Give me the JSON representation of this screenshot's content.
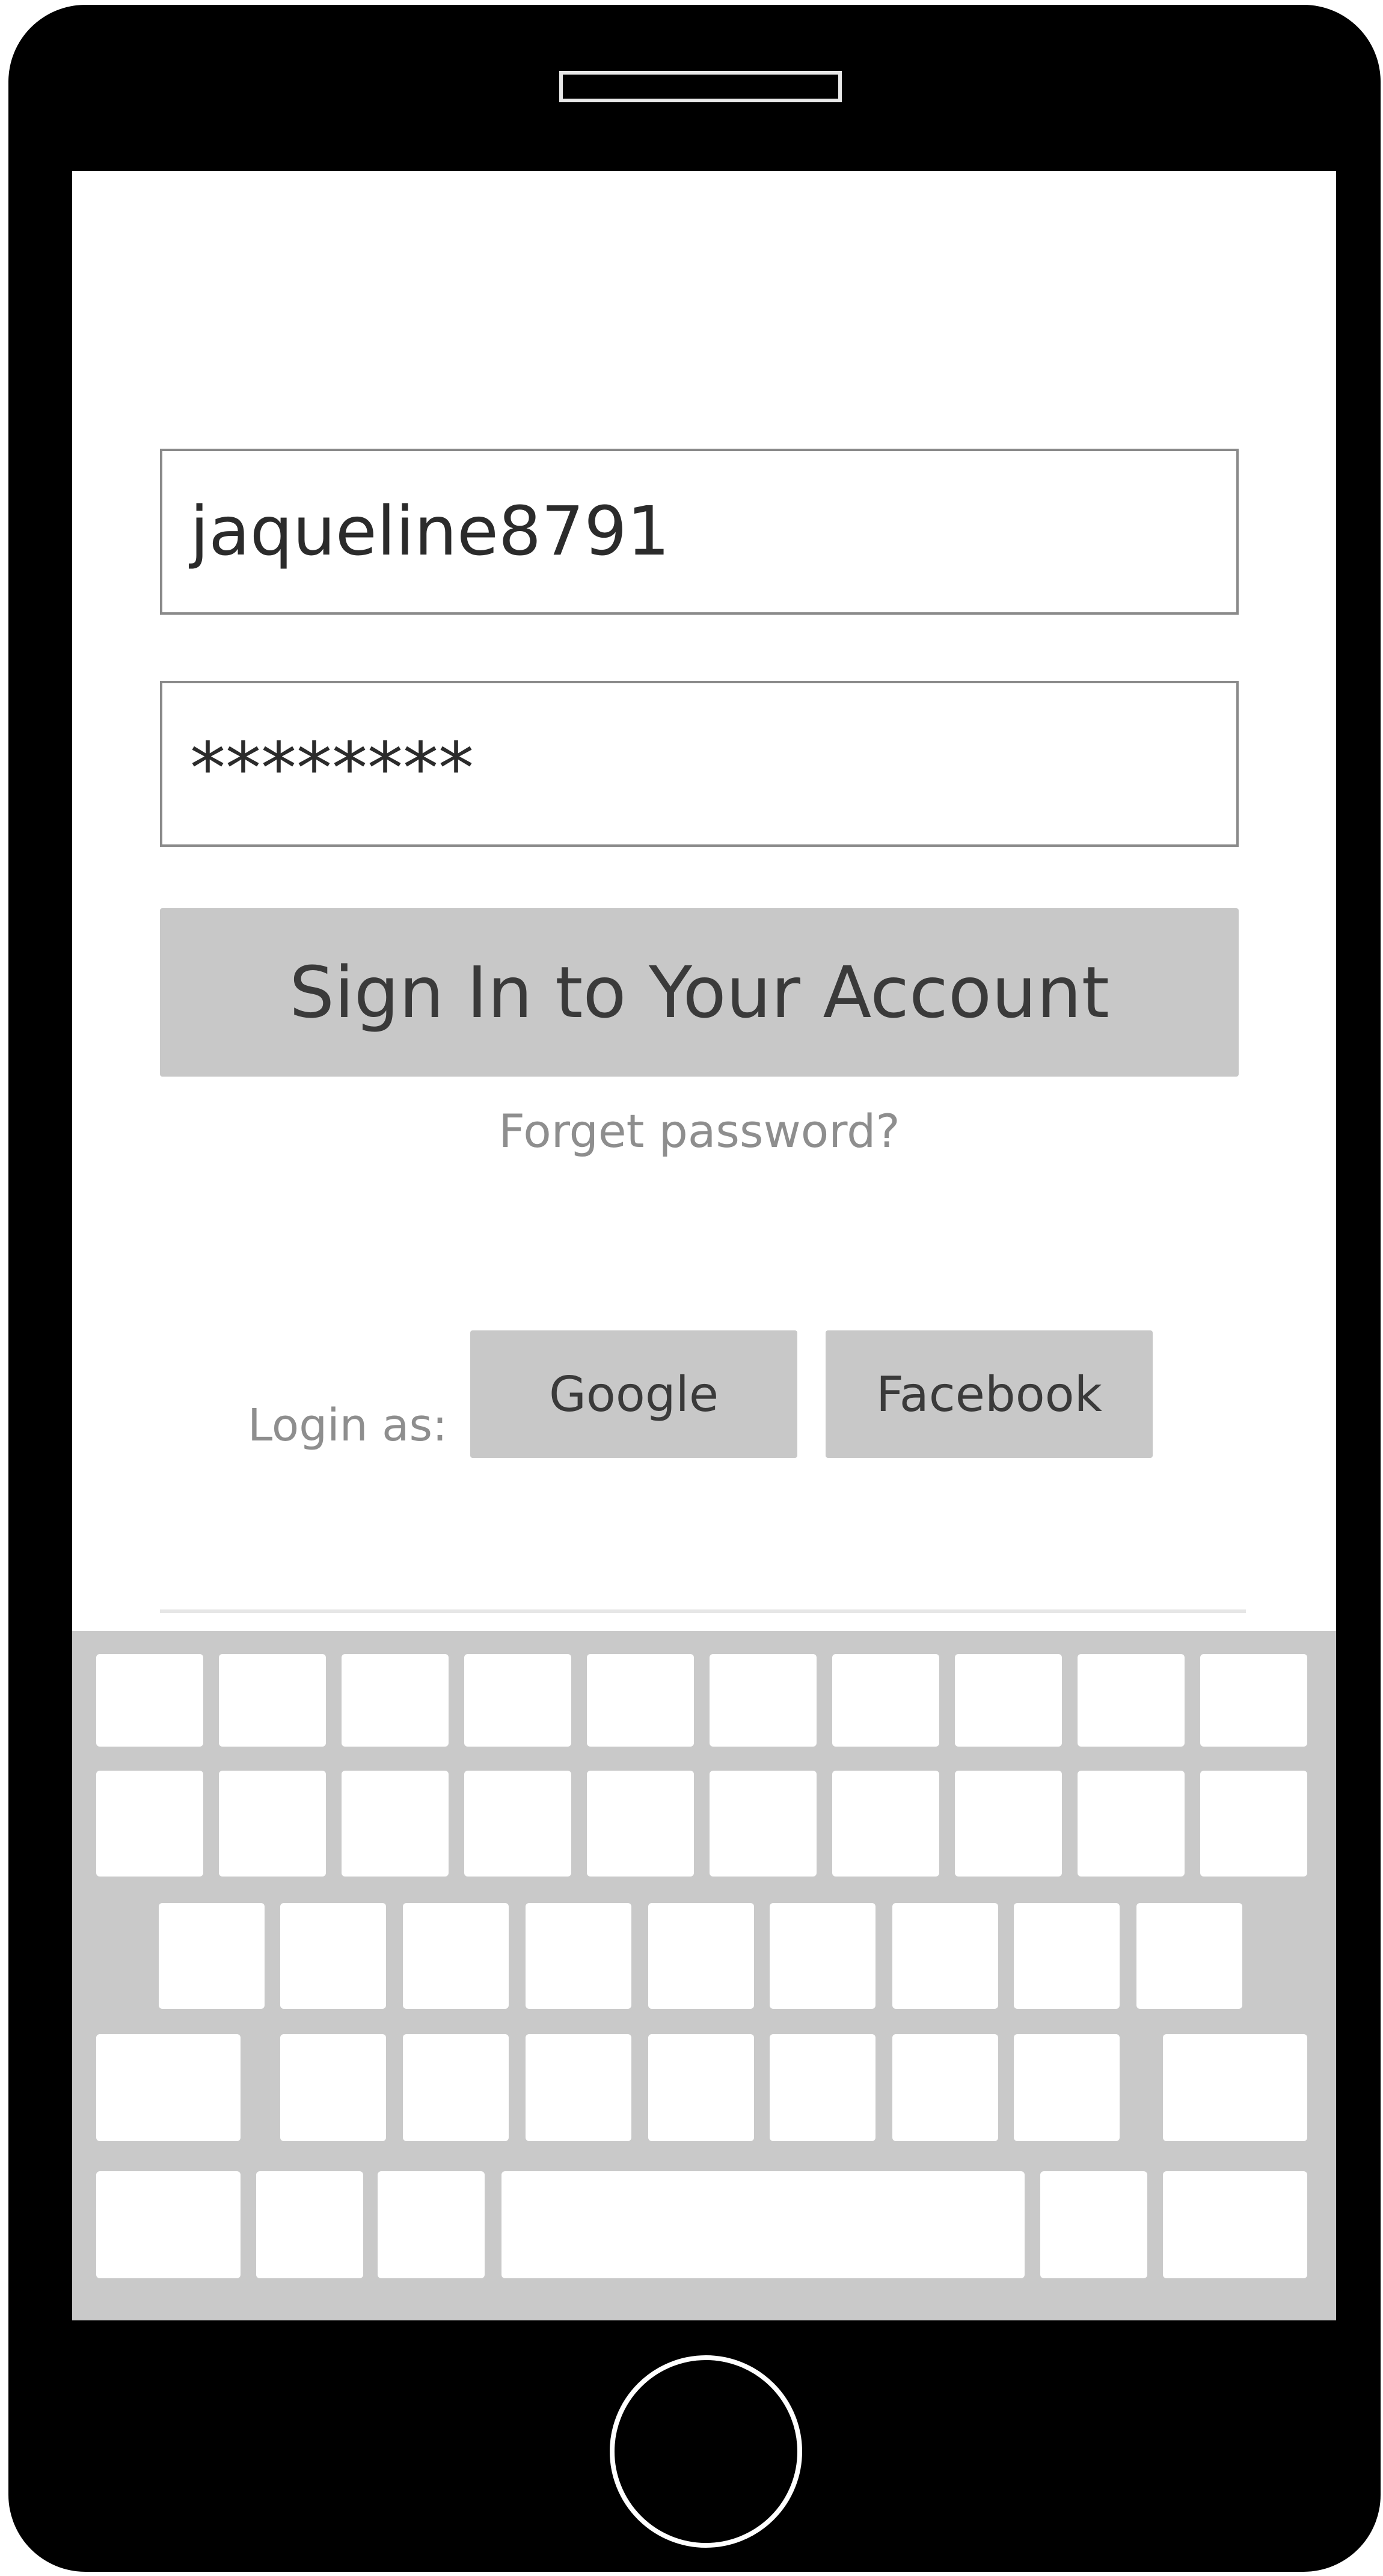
{
  "login_form": {
    "username_value": "jaqueline8791",
    "password_value": "********",
    "sign_in_label": "Sign In to Your Account",
    "forget_password_label": "Forget password?"
  },
  "social_login": {
    "label": "Login as:",
    "google_label": "Google",
    "facebook_label": "Facebook"
  },
  "colors": {
    "button_gray": "#c8c8c8",
    "keyboard_gray": "#c9c9c9",
    "phone_body": "#000000"
  },
  "icons": {
    "speaker": "speaker-slot-icon",
    "home": "home-button-icon"
  }
}
